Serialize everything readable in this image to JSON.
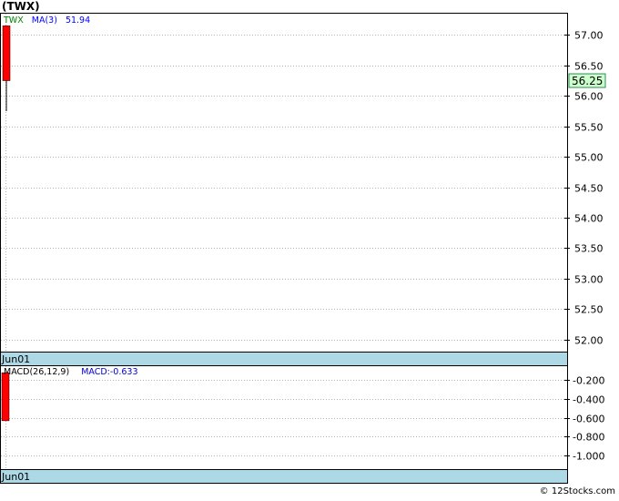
{
  "title": "(TWX)",
  "watermark": "© 12Stocks.com",
  "colors": {
    "bull": "#00aa00",
    "bear": "#ff0000",
    "ma_text": "#0000ff",
    "ticker_text": "#008000",
    "grid": "#b5b5b5",
    "date_bar": "#add8e6",
    "last_price_bg": "#ccffcc",
    "last_price_border": "#2e8b57",
    "macd_text": "#0000cc"
  },
  "chart_data": [
    {
      "type": "candlestick",
      "legend": {
        "ticker": "TWX",
        "ma_label": "MA(3)",
        "ma_value": "51.94"
      },
      "ylim": [
        51.8,
        57.35
      ],
      "y_ticks": [
        "57.00",
        "56.50",
        "56.00",
        "55.50",
        "55.00",
        "54.50",
        "54.00",
        "53.50",
        "53.00",
        "52.50",
        "52.00"
      ],
      "y_tick_values": [
        57.0,
        56.5,
        56.0,
        55.5,
        55.0,
        54.5,
        54.0,
        53.5,
        53.0,
        52.5,
        52.0
      ],
      "last_price": "56.25",
      "last_price_value": 56.25,
      "x_labels": [
        "Jun01"
      ],
      "candles": [
        {
          "open": 57.15,
          "high": 57.15,
          "low": 55.75,
          "close": 56.25
        }
      ],
      "grid": true
    },
    {
      "type": "bar",
      "legend": {
        "label": "MACD(26,12,9)",
        "value_label": "MACD:-0.633"
      },
      "ylim": [
        -1.15,
        -0.05
      ],
      "y_ticks": [
        "-0.200",
        "-0.400",
        "-0.600",
        "-0.800",
        "-1.000"
      ],
      "y_tick_values": [
        -0.2,
        -0.4,
        -0.6,
        -0.8,
        -1.0
      ],
      "x_labels": [
        "Jun01"
      ],
      "values": [
        -0.633
      ],
      "grid": true
    }
  ]
}
